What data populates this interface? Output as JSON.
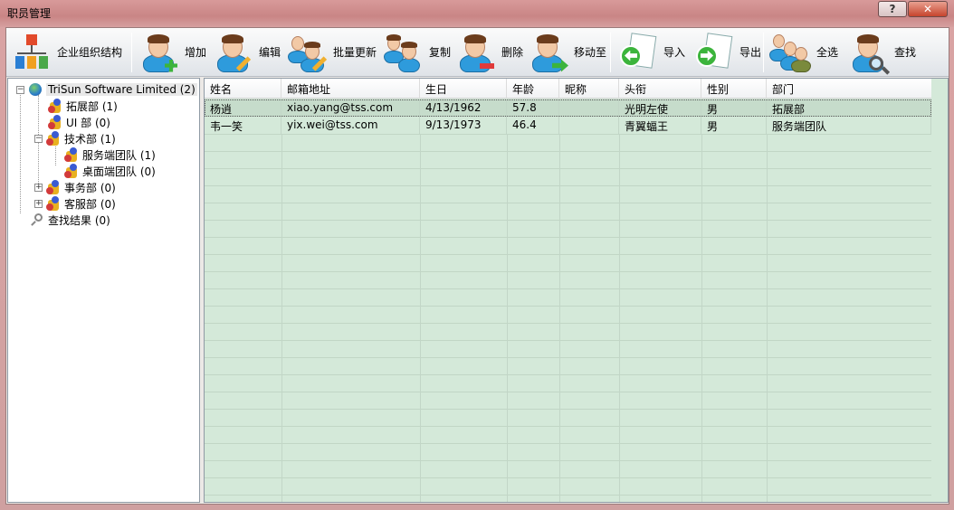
{
  "window": {
    "title": "职员管理",
    "help": "?",
    "close": "✕"
  },
  "toolbar": {
    "org": "企业组织结构",
    "add": "增加",
    "edit": "编辑",
    "batch": "批量更新",
    "copy": "复制",
    "del": "删除",
    "move": "移动至",
    "import": "导入",
    "export": "导出",
    "selectall": "全选",
    "find": "查找"
  },
  "tree": {
    "root": "TriSun Software Limited (2)",
    "n1": "拓展部 (1)",
    "n2": "UI 部 (0)",
    "n3": "技术部 (1)",
    "n3a": "服务端团队 (1)",
    "n3b": "桌面端团队 (0)",
    "n4": "事务部 (0)",
    "n5": "客服部 (0)",
    "search": "查找结果 (0)"
  },
  "grid": {
    "headers": [
      "姓名",
      "邮箱地址",
      "生日",
      "年龄",
      "昵称",
      "头衔",
      "性别",
      "部门"
    ],
    "rows": [
      [
        "杨逍",
        "xiao.yang@tss.com",
        "4/13/1962",
        "57.8",
        "",
        "光明左使",
        "男",
        "拓展部"
      ],
      [
        "韦一笑",
        "yix.wei@tss.com",
        "9/13/1973",
        "46.4",
        "",
        "青翼蝠王",
        "男",
        "服务端团队"
      ]
    ]
  },
  "colors": {
    "grid_bg": "#d4e9d9",
    "title_bg": "#c98585",
    "selected_row": "#cfe3d4"
  }
}
